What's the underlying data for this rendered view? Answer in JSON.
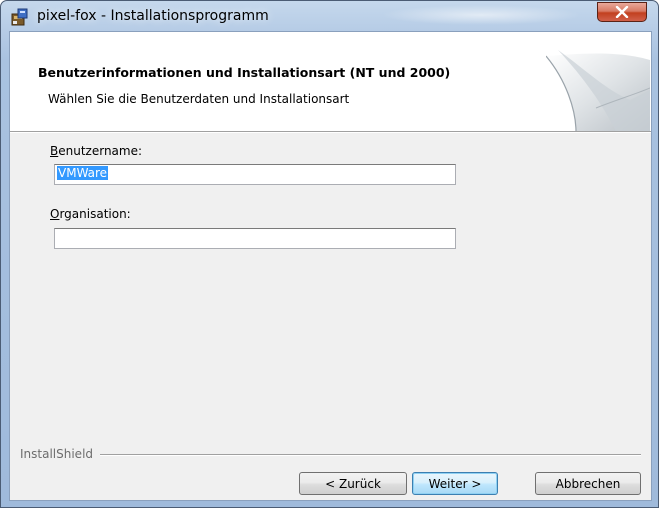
{
  "window": {
    "title": "pixel-fox - Installationsprogramm",
    "close_label": "X"
  },
  "header": {
    "title": "Benutzerinformationen und Installationsart (NT und 2000)",
    "subtitle": "Wählen Sie die Benutzerdaten und Installationsart"
  },
  "form": {
    "username": {
      "label_accel": "B",
      "label_rest": "enutzername:",
      "value": "VMWare"
    },
    "organisation": {
      "label_accel": "O",
      "label_rest": "rganisation:",
      "value": ""
    }
  },
  "footer": {
    "brand": "InstallShield",
    "back_label": "< Zurück",
    "next_label": "Weiter >",
    "cancel_label": "Abbrechen"
  },
  "colors": {
    "selection": "#3399ff",
    "close_button": "#c2401f",
    "default_button": "#3c7fb1"
  }
}
